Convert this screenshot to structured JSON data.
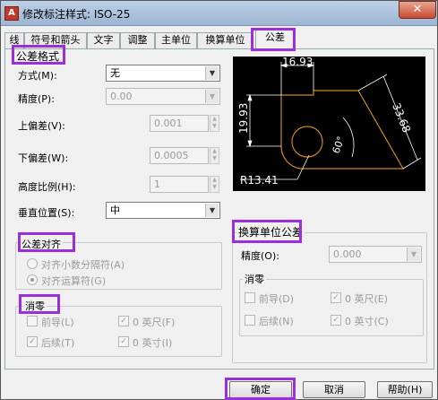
{
  "window": {
    "title": "修改标注样式: ISO-25",
    "close_symbol": "✕",
    "app_icon_letter": "A"
  },
  "tabs": [
    {
      "label": "线",
      "active": false
    },
    {
      "label": "符号和箭头",
      "active": false
    },
    {
      "label": "文字",
      "active": false
    },
    {
      "label": "调整",
      "active": false
    },
    {
      "label": "主单位",
      "active": false
    },
    {
      "label": "换算单位",
      "active": false
    },
    {
      "label": "公差",
      "active": true
    }
  ],
  "tolerance_format": {
    "title": "公差格式",
    "method_label": "方式(M):",
    "method_value": "无",
    "precision_label": "精度(P):",
    "precision_value": "0.00",
    "upper_label": "上偏差(V):",
    "upper_value": "0.001",
    "lower_label": "下偏差(W):",
    "lower_value": "0.0005",
    "scale_label": "高度比例(H):",
    "scale_value": "1",
    "vpos_label": "垂直位置(S):",
    "vpos_value": "中"
  },
  "tolerance_align": {
    "title": "公差对齐",
    "opt1": "对齐小数分隔符(A)",
    "opt2": "对齐运算符(G)",
    "selected": "opt2"
  },
  "zero_suppress": {
    "title": "消零",
    "leading": "前导(L)",
    "leading_checked": false,
    "trailing": "后续(T)",
    "trailing_checked": true,
    "feet": "0 英尺(F)",
    "feet_checked": true,
    "inches": "0 英寸(I)",
    "inches_checked": true
  },
  "preview": {
    "dim_top": "16.93",
    "dim_left": "19.93",
    "dim_right": "33.68",
    "dim_angle": "60°",
    "dim_radius": "R13.41"
  },
  "alt_units": {
    "title": "换算单位公差",
    "precision_label": "精度(O):",
    "precision_value": "0.000",
    "zero_title": "消零",
    "leading": "前导(D)",
    "leading_checked": false,
    "trailing": "后续(N)",
    "trailing_checked": false,
    "feet": "0 英尺(E)",
    "feet_checked": true,
    "inches": "0 英寸(C)",
    "inches_checked": true
  },
  "buttons": {
    "ok": "确定",
    "cancel": "取消",
    "help": "帮助(H)"
  },
  "colors": {
    "highlight": "#9b2fdc",
    "preview_geometry": "#d08a12",
    "preview_dims": "#ffffff"
  }
}
